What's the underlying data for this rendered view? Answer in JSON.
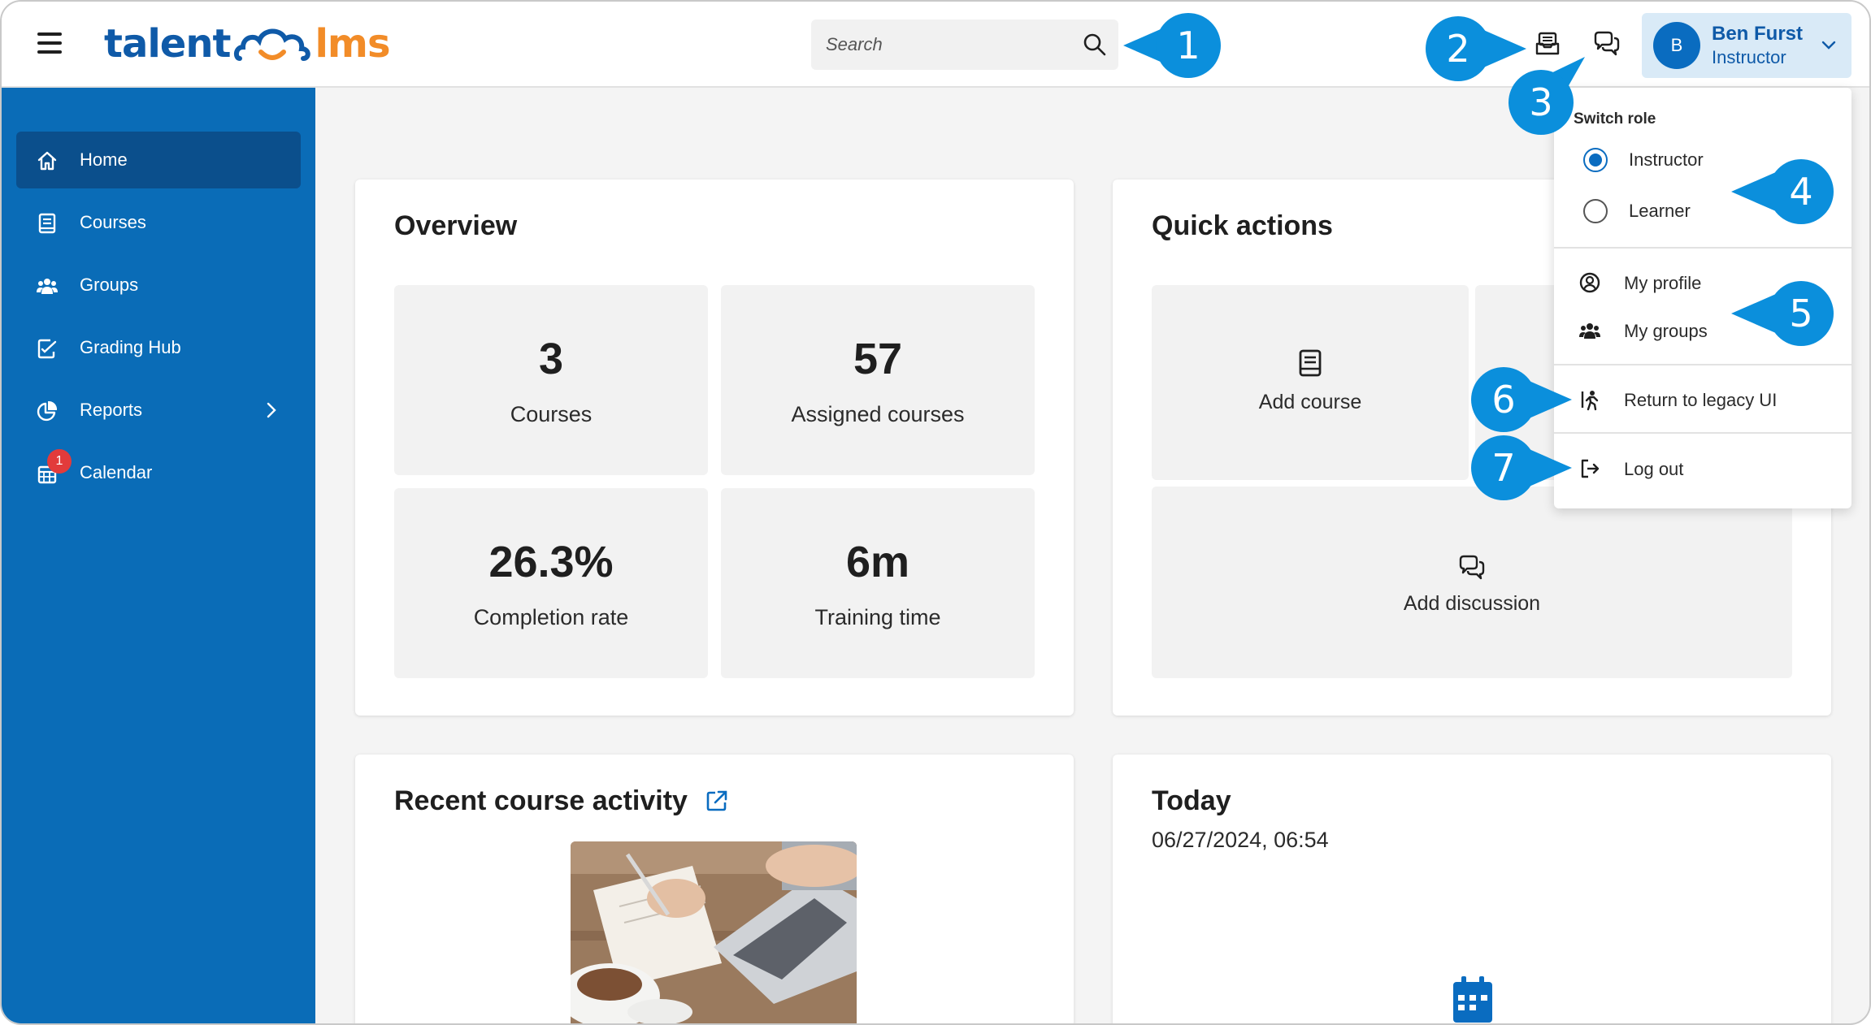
{
  "header": {
    "logo_part1": "talent",
    "logo_part2": "lms",
    "search_placeholder": "Search",
    "user": {
      "initial": "B",
      "name": "Ben Furst",
      "role": "Instructor"
    }
  },
  "sidebar": {
    "items": [
      {
        "label": "Home",
        "icon": "home-icon"
      },
      {
        "label": "Courses",
        "icon": "book-icon"
      },
      {
        "label": "Groups",
        "icon": "users-icon"
      },
      {
        "label": "Grading Hub",
        "icon": "grading-icon"
      },
      {
        "label": "Reports",
        "icon": "pie-chart-icon"
      },
      {
        "label": "Calendar",
        "icon": "calendar-icon",
        "badge": "1"
      }
    ]
  },
  "overview": {
    "title": "Overview",
    "stats": [
      {
        "value": "3",
        "label": "Courses"
      },
      {
        "value": "57",
        "label": "Assigned courses"
      },
      {
        "value": "26.3%",
        "label": "Completion rate"
      },
      {
        "value": "6m",
        "label": "Training time"
      }
    ]
  },
  "quick_actions": {
    "title": "Quick actions",
    "add_course": "Add course",
    "add_discussion": "Add discussion"
  },
  "recent_activity": {
    "title": "Recent course activity"
  },
  "today": {
    "title": "Today",
    "datetime": "06/27/2024, 06:54"
  },
  "dropdown": {
    "switch_role_heading": "Switch role",
    "roles": [
      "Instructor",
      "Learner"
    ],
    "selected_role": "Instructor",
    "my_profile": "My profile",
    "my_groups": "My groups",
    "legacy_ui": "Return to legacy UI",
    "logout": "Log out"
  },
  "callouts": [
    "1",
    "2",
    "3",
    "4",
    "5",
    "6",
    "7"
  ],
  "colors": {
    "sidebar": "#0a6cb7",
    "sidebar_active": "#0b4f8c",
    "callout": "#0b8fdc",
    "brand_blue": "#0f5aa8",
    "brand_orange": "#f28c28"
  }
}
